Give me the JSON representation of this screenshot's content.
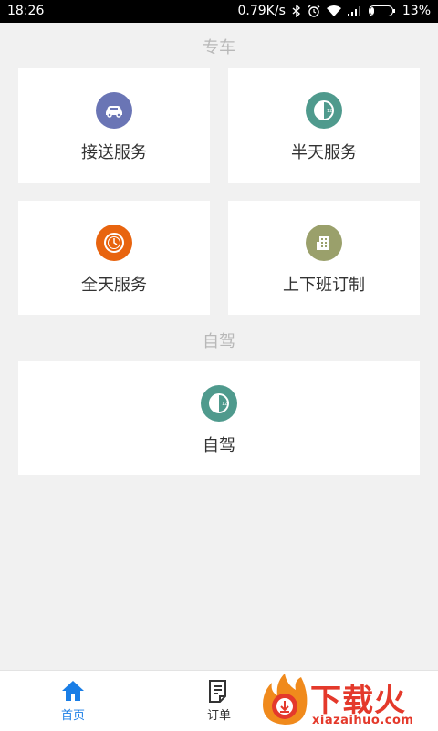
{
  "status_bar": {
    "time": "18:26",
    "speed": "0.79K/s",
    "battery": "13%",
    "icons": [
      "bluetooth-icon",
      "alarm-icon",
      "wifi-icon",
      "signal-icon",
      "battery-icon"
    ]
  },
  "sections": {
    "chauffeur": {
      "title": "专车",
      "cards": [
        {
          "label": "接送服务",
          "icon": "car-icon",
          "color": "#6a75b5"
        },
        {
          "label": "半天服务",
          "icon": "half-clock-icon",
          "color": "#4f9a8d"
        },
        {
          "label": "全天服务",
          "icon": "clock-icon",
          "color": "#e8640f"
        },
        {
          "label": "上下班订制",
          "icon": "building-icon",
          "color": "#9aa06b"
        }
      ]
    },
    "self_drive": {
      "title": "自驾",
      "cards": [
        {
          "label": "自驾",
          "icon": "half-clock-icon",
          "color": "#4f9a8d"
        }
      ]
    }
  },
  "tab_bar": {
    "tabs": [
      {
        "label": "首页",
        "icon": "home-icon",
        "active": true,
        "color": "#1a7ee6"
      },
      {
        "label": "订单",
        "icon": "order-icon",
        "active": false,
        "color": "#333333"
      }
    ]
  },
  "watermark": {
    "text": "下载火",
    "url": "xiazaihuo.com",
    "color": "#e4392b"
  }
}
